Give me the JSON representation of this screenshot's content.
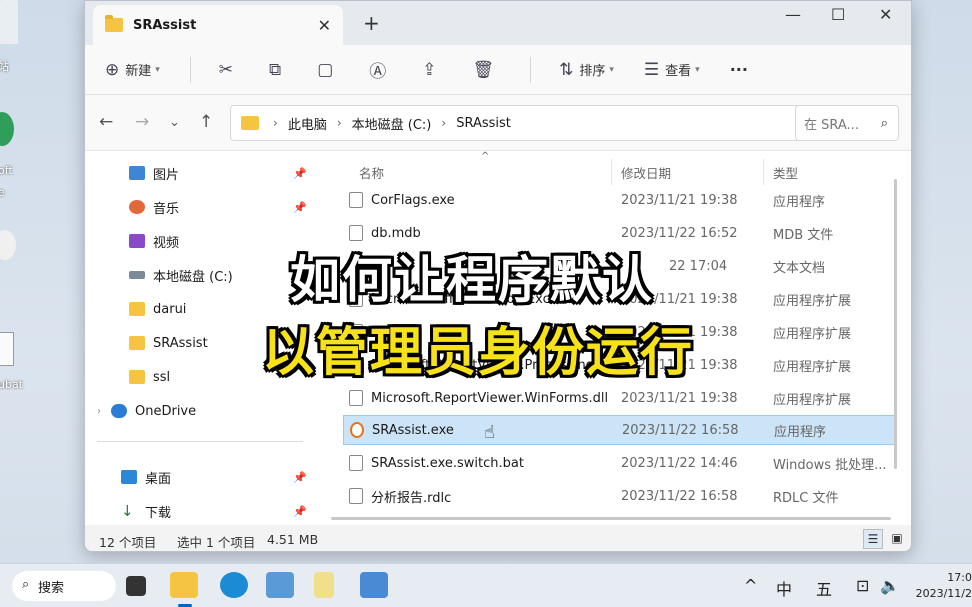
{
  "desktop": {
    "labels": [
      "站",
      "oft",
      "e",
      "ubat"
    ]
  },
  "window": {
    "tab_title": "SRAssist",
    "tab_close": "✕",
    "new_tab": "+",
    "controls": {
      "minimize": "—",
      "maximize": "☐",
      "close": "✕"
    }
  },
  "toolbar": {
    "new_label": "新建",
    "sort_label": "排序",
    "view_label": "查看",
    "more_label": "···"
  },
  "address": {
    "crumbs": [
      "此电脑",
      "本地磁盘 (C:)",
      "SRAssist"
    ],
    "search_placeholder": "在 SRA..."
  },
  "sidebar": {
    "items": [
      {
        "label": "图片",
        "pinned": true,
        "icon": "pictures-icon"
      },
      {
        "label": "音乐",
        "pinned": true,
        "icon": "music-icon"
      },
      {
        "label": "视频",
        "pinned": true,
        "icon": "video-icon"
      },
      {
        "label": "本地磁盘 (C:)",
        "pinned": false,
        "icon": "drive-icon"
      },
      {
        "label": "darui",
        "pinned": false,
        "icon": "folder-icon"
      },
      {
        "label": "SRAssist",
        "pinned": false,
        "icon": "folder-icon"
      },
      {
        "label": "ssl",
        "pinned": false,
        "icon": "folder-icon"
      },
      {
        "label": "OneDrive",
        "pinned": false,
        "icon": "cloud-icon"
      },
      {
        "label": "桌面",
        "pinned": true,
        "icon": "desktop-icon"
      },
      {
        "label": "下载",
        "pinned": true,
        "icon": "download-icon"
      }
    ]
  },
  "columns": {
    "name": "名称",
    "date": "修改日期",
    "type": "类型"
  },
  "files": [
    {
      "name": "CorFlags.exe",
      "date": "2023/11/21 19:38",
      "type": "应用程序"
    },
    {
      "name": "db.mdb",
      "date": "2023/11/22 16:52",
      "type": "MDB 文件"
    },
    {
      "name": "",
      "date": "22 17:04",
      "type": "文本文档"
    },
    {
      "name": "Microsoft.Office.Interop.Excel.dll",
      "date": "2023/11/21 19:38",
      "type": "应用程序扩展"
    },
    {
      "name": "",
      "date": "2023/11/21 19:38",
      "type": "应用程序扩展"
    },
    {
      "name": "Microsoft.ReportViewer.ProcessingObj",
      "date": "2023/11/21 19:38",
      "type": "应用程序扩展"
    },
    {
      "name": "Microsoft.ReportViewer.WinForms.dll",
      "date": "2023/11/21 19:38",
      "type": "应用程序扩展"
    },
    {
      "name": "SRAssist.exe",
      "date": "2023/11/22 16:58",
      "type": "应用程序",
      "selected": true
    },
    {
      "name": "SRAssist.exe.switch.bat",
      "date": "2023/11/22 14:46",
      "type": "Windows 批处理..."
    },
    {
      "name": "分析报告.rdlc",
      "date": "2023/11/22 16:58",
      "type": "RDLC 文件"
    }
  ],
  "status": {
    "count": "12 个项目",
    "selected": "选中 1 个项目",
    "size": "4.51 MB"
  },
  "caption": {
    "line1": "如何让程序默认",
    "line2": "以管理员身份运行"
  },
  "taskbar": {
    "search_label": "搜索",
    "ime_1": "中",
    "ime_2": "五",
    "time": "17:0",
    "date": "2023/11/2"
  }
}
